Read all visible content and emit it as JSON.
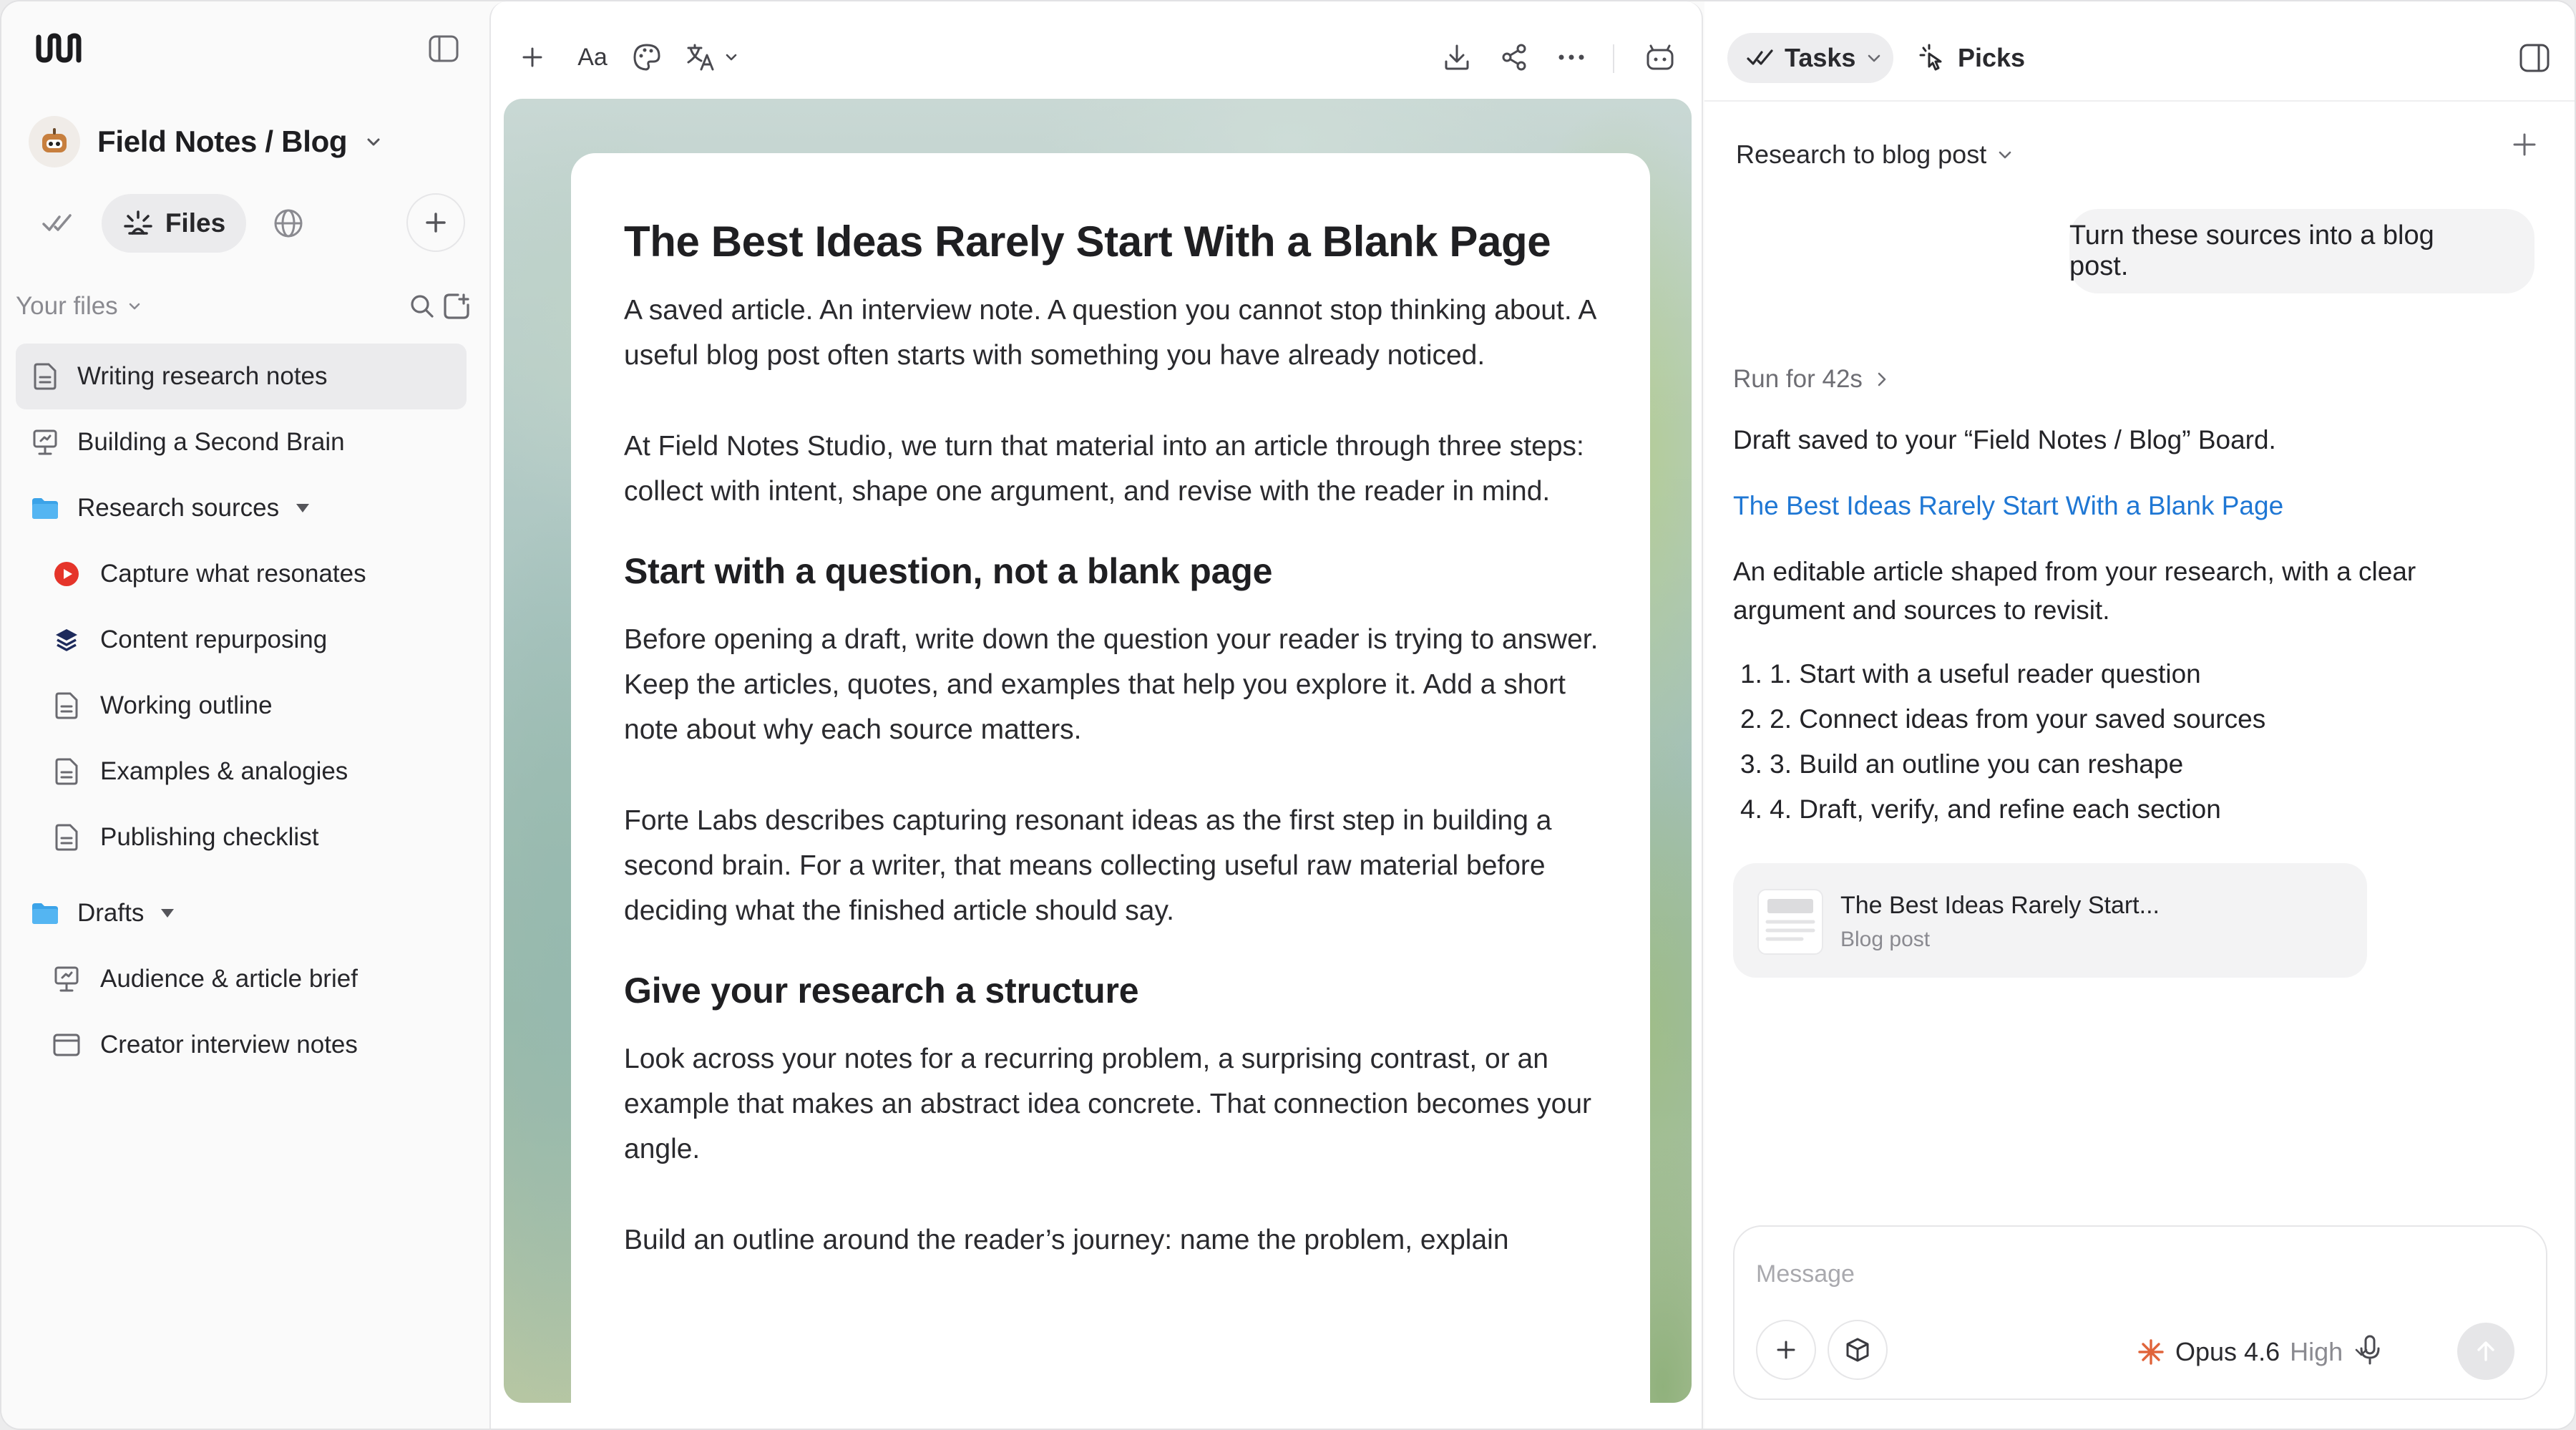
{
  "workspace": {
    "name": "Field Notes / Blog"
  },
  "sidebar": {
    "files_label": "Files",
    "your_files_label": "Your files",
    "items": [
      {
        "label": "Writing research notes",
        "icon": "document-icon",
        "selected": true
      },
      {
        "label": "Building a Second Brain",
        "icon": "presentation-icon"
      },
      {
        "label": "Research sources",
        "icon": "folder-icon",
        "folder": true
      },
      {
        "label": "Capture what resonates",
        "icon": "youtube-icon"
      },
      {
        "label": "Content repurposing",
        "icon": "layers-icon"
      },
      {
        "label": "Working outline",
        "icon": "document-icon"
      },
      {
        "label": "Examples & analogies",
        "icon": "document-icon"
      },
      {
        "label": "Publishing checklist",
        "icon": "document-icon"
      },
      {
        "label": "Drafts",
        "icon": "folder-icon",
        "folder": true
      },
      {
        "label": "Audience & article brief",
        "icon": "presentation-icon"
      },
      {
        "label": "Creator interview notes",
        "icon": "browser-icon"
      }
    ]
  },
  "toolbar": {
    "font_label": "Aa"
  },
  "document": {
    "title": "The Best Ideas Rarely Start With a Blank Page",
    "p1": "A saved article. An interview note. A question you cannot stop thinking about. A useful blog post often starts with something you have already noticed.",
    "p2": "At Field Notes Studio, we turn that material into an article through three steps: collect with intent, shape one argument, and revise with the reader in mind.",
    "h2_1": "Start with a question, not a blank page",
    "p3": "Before opening a draft, write down the question your reader is trying to answer. Keep the articles, quotes, and examples that help you explore it. Add a short note about why each source matters.",
    "p4": "Forte Labs describes capturing resonant ideas as the first step in building a second brain. For a writer, that means collecting useful raw material before deciding what the finished article should say.",
    "h2_2": "Give your research a structure",
    "p5": "Look across your notes for a recurring problem, a surprising contrast, or an example that makes an abstract idea concrete. That connection becomes your angle.",
    "p6": "Build an outline around the reader’s journey: name the problem, explain"
  },
  "right_panel": {
    "tabs": {
      "tasks": "Tasks",
      "picks": "Picks"
    },
    "flow_label": "Research to blog post",
    "user_message": "Turn these sources into a blog post.",
    "run_label": "Run for 42s",
    "assistant": {
      "saved": "Draft saved to your “Field Notes / Blog” Board.",
      "link": "The Best Ideas Rarely Start With a Blank Page",
      "summary": "An editable article shaped from your research, with a clear argument and sources to revisit.",
      "steps": [
        "1. 1. Start with a useful reader question",
        "2. 2. Connect ideas from your saved sources",
        "3. 3. Build an outline you can reshape",
        "4. 4. Draft, verify, and refine each section"
      ]
    },
    "attachment": {
      "title": "The Best Ideas Rarely Start...",
      "subtitle": "Blog post"
    },
    "composer": {
      "placeholder": "Message",
      "model": "Opus 4.6",
      "effort": "High"
    }
  },
  "colors": {
    "link": "#1f77d4",
    "folder": "#3ba3e8",
    "youtube": "#e5342a",
    "model_spark": "#e0643a"
  }
}
